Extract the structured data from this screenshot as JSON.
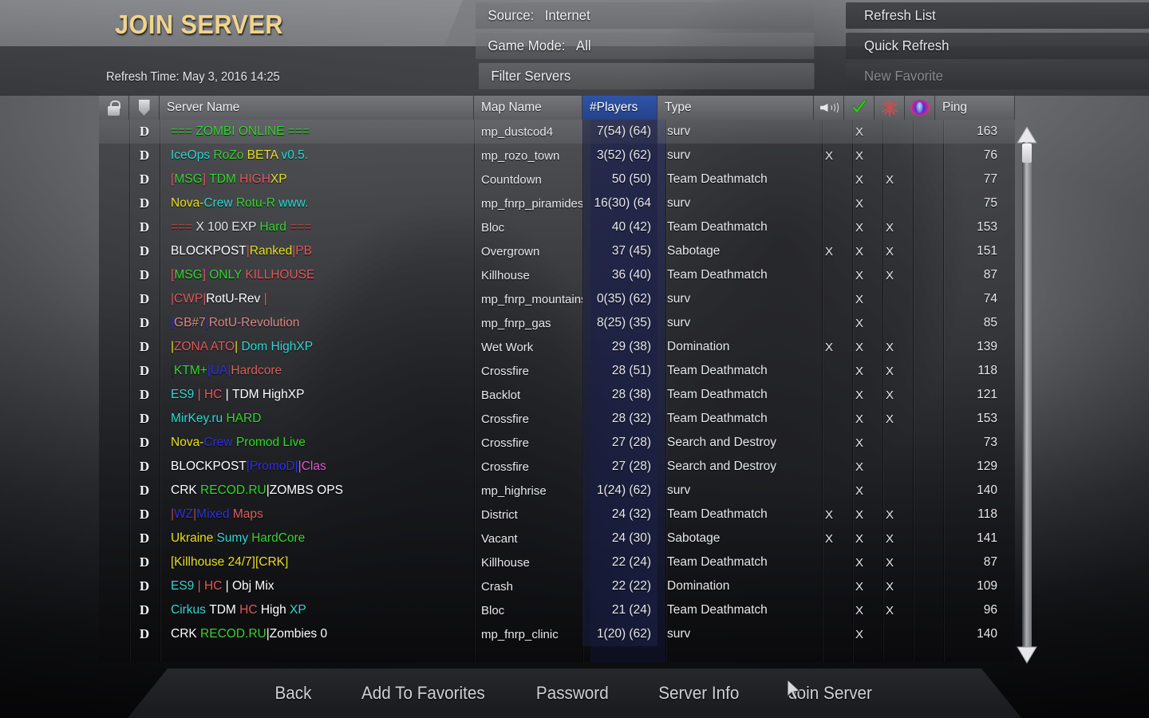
{
  "header": {
    "title": "JOIN SERVER",
    "refresh_time_label": "Refresh Time:",
    "refresh_time_value": "May 3, 2016  14:25"
  },
  "filters": {
    "source_label": "Source:",
    "source_value": "Internet",
    "gamemode_label": "Game Mode:",
    "gamemode_value": "All",
    "filter_servers_label": "Filter Servers"
  },
  "actions": {
    "refresh_list": "Refresh List",
    "quick_refresh": "Quick Refresh",
    "new_favorite": "New Favorite"
  },
  "columns": {
    "lock": "lock-icon",
    "mods": "shield-icon",
    "server_name": "Server Name",
    "map_name": "Map Name",
    "players": "#Players",
    "type": "Type",
    "voice": "speaker-icon",
    "pure": "green-check-icon",
    "mod": "red-star-icon",
    "dedicated": "globe-icon",
    "ping": "Ping",
    "sorted_column": "#Players"
  },
  "colors": {
    "title": "#f0d48c",
    "sorted_header": "#2f55a8",
    "green": "#38d430",
    "cyan": "#2fd9d0",
    "yellow": "#e8e020",
    "red": "#e05a5a",
    "blue": "#3030e0",
    "magenta": "#d95fd0",
    "white": "#ffffff"
  },
  "rows": [
    {
      "ded": "D",
      "name_segments": [
        {
          "t": "=== ",
          "c": "#38d430"
        },
        {
          "t": "ZOMBI ONLINE",
          "c": "#38d430"
        },
        {
          "t": " ===",
          "c": "#38d430"
        }
      ],
      "map": "mp_dustcod4",
      "players": "7(54) (64)",
      "type": "surv",
      "voice": "",
      "pure": "X",
      "mod": "",
      "dedicated": "",
      "ping": "163",
      "selected": true
    },
    {
      "ded": "D",
      "name_segments": [
        {
          "t": "IceOps ",
          "c": "#2fd9d0"
        },
        {
          "t": "RoZo ",
          "c": "#38d430"
        },
        {
          "t": "BETA ",
          "c": "#e8e020"
        },
        {
          "t": "v0.5.",
          "c": "#2fd9d0"
        }
      ],
      "map": "mp_rozo_town",
      "players": "3(52) (62)",
      "type": "surv",
      "voice": "X",
      "pure": "X",
      "mod": "",
      "dedicated": "",
      "ping": "76",
      "selected": false
    },
    {
      "ded": "D",
      "name_segments": [
        {
          "t": "[",
          "c": "#e05a5a"
        },
        {
          "t": "MSG",
          "c": "#38d430"
        },
        {
          "t": "] ",
          "c": "#e05a5a"
        },
        {
          "t": "TDM ",
          "c": "#38d430"
        },
        {
          "t": "HIGH",
          "c": "#e05a5a"
        },
        {
          "t": "XP",
          "c": "#e8e020"
        }
      ],
      "map": "Countdown",
      "players": "50 (50)",
      "type": "Team Deathmatch",
      "voice": "",
      "pure": "X",
      "mod": "X",
      "dedicated": "",
      "ping": "77",
      "selected": false
    },
    {
      "ded": "D",
      "name_segments": [
        {
          "t": "Nova-",
          "c": "#e8e020"
        },
        {
          "t": "Crew ",
          "c": "#2fd9d0"
        },
        {
          "t": "Rotu-R ",
          "c": "#38d430"
        },
        {
          "t": "www.",
          "c": "#2fd9d0"
        }
      ],
      "map": "mp_fnrp_piramides",
      "players": "16(30) (64",
      "type": "surv",
      "voice": "",
      "pure": "X",
      "mod": "",
      "dedicated": "",
      "ping": "75",
      "selected": false
    },
    {
      "ded": "D",
      "name_segments": [
        {
          "t": "=== ",
          "c": "#c04a4a"
        },
        {
          "t": "X 100 EXP ",
          "c": "#e9e9ec"
        },
        {
          "t": "Hard ",
          "c": "#38d430"
        },
        {
          "t": "===",
          "c": "#c04a4a"
        }
      ],
      "map": "Bloc",
      "players": "40 (42)",
      "type": "Team Deathmatch",
      "voice": "",
      "pure": "X",
      "mod": "X",
      "dedicated": "",
      "ping": "153",
      "selected": false
    },
    {
      "ded": "D",
      "name_segments": [
        {
          "t": "BLOCKPOST",
          "c": "#ffffff"
        },
        {
          "t": "|",
          "c": "#e05a5a"
        },
        {
          "t": "Ranked",
          "c": "#e8e020"
        },
        {
          "t": "|",
          "c": "#e05a5a"
        },
        {
          "t": "PB",
          "c": "#e05a5a"
        }
      ],
      "map": "Overgrown",
      "players": "37 (45)",
      "type": "Sabotage",
      "voice": "X",
      "pure": "X",
      "mod": "X",
      "dedicated": "",
      "ping": "151",
      "selected": false
    },
    {
      "ded": "D",
      "name_segments": [
        {
          "t": "[",
          "c": "#e05a5a"
        },
        {
          "t": "MSG",
          "c": "#38d430"
        },
        {
          "t": "] ",
          "c": "#e05a5a"
        },
        {
          "t": "ONLY ",
          "c": "#38d430"
        },
        {
          "t": "KILLHOUSE",
          "c": "#e05a5a"
        }
      ],
      "map": "Killhouse",
      "players": "36 (40)",
      "type": "Team Deathmatch",
      "voice": "",
      "pure": "X",
      "mod": "X",
      "dedicated": "",
      "ping": "87",
      "selected": false
    },
    {
      "ded": "D",
      "name_segments": [
        {
          "t": "|",
          "c": "#e05a5a"
        },
        {
          "t": "CWP",
          "c": "#e05a5a"
        },
        {
          "t": "|",
          "c": "#e05a5a"
        },
        {
          "t": "RotU-Rev ",
          "c": "#ffffff"
        },
        {
          "t": "|",
          "c": "#e05a5a"
        }
      ],
      "map": "mp_fnrp_mountains",
      "players": "0(35) (62)",
      "type": "surv",
      "voice": "",
      "pure": "X",
      "mod": "",
      "dedicated": "",
      "ping": "74",
      "selected": false
    },
    {
      "ded": "D",
      "name_segments": [
        {
          "t": "|",
          "c": "#3030e0"
        },
        {
          "t": "GB#7",
          "c": "#d98a8a"
        },
        {
          "t": "|",
          "c": "#3030e0"
        },
        {
          "t": "RotU-Revolution",
          "c": "#d98a8a"
        }
      ],
      "map": "mp_fnrp_gas",
      "players": "8(25) (35)",
      "type": "surv",
      "voice": "",
      "pure": "X",
      "mod": "",
      "dedicated": "",
      "ping": "85",
      "selected": false
    },
    {
      "ded": "D",
      "name_segments": [
        {
          "t": "|",
          "c": "#e8e020"
        },
        {
          "t": "ZONA ATO",
          "c": "#e05a5a"
        },
        {
          "t": "|",
          "c": "#e8e020"
        },
        {
          "t": " Dom HighXP",
          "c": "#2fd9d0"
        }
      ],
      "map": "Wet Work",
      "players": "29 (38)",
      "type": "Domination",
      "voice": "X",
      "pure": "X",
      "mod": "X",
      "dedicated": "",
      "ping": "139",
      "selected": false
    },
    {
      "ded": "D",
      "name_segments": [
        {
          "t": "|",
          "c": "#2a2a2a"
        },
        {
          "t": "KTM+",
          "c": "#38d430"
        },
        {
          "t": "|",
          "c": "#3030e0"
        },
        {
          "t": "UA",
          "c": "#3030e0"
        },
        {
          "t": "|",
          "c": "#3030e0"
        },
        {
          "t": "Hardcore",
          "c": "#d96060"
        }
      ],
      "map": "Crossfire",
      "players": "28 (51)",
      "type": "Team Deathmatch",
      "voice": "",
      "pure": "X",
      "mod": "X",
      "dedicated": "",
      "ping": "118",
      "selected": false
    },
    {
      "ded": "D",
      "name_segments": [
        {
          "t": "ES9 ",
          "c": "#2fd9d0"
        },
        {
          "t": "| ",
          "c": "#e05a5a"
        },
        {
          "t": "HC ",
          "c": "#e05a5a"
        },
        {
          "t": "| ",
          "c": "#ffffff"
        },
        {
          "t": "TDM HighXP",
          "c": "#ffffff"
        }
      ],
      "map": "Backlot",
      "players": "28 (38)",
      "type": "Team Deathmatch",
      "voice": "",
      "pure": "X",
      "mod": "X",
      "dedicated": "",
      "ping": "121",
      "selected": false
    },
    {
      "ded": "D",
      "name_segments": [
        {
          "t": "MirKey.ru ",
          "c": "#2fd9d0"
        },
        {
          "t": "HARD",
          "c": "#38d430"
        }
      ],
      "map": "Crossfire",
      "players": "28 (32)",
      "type": "Team Deathmatch",
      "voice": "",
      "pure": "X",
      "mod": "X",
      "dedicated": "",
      "ping": "153",
      "selected": false
    },
    {
      "ded": "D",
      "name_segments": [
        {
          "t": "Nova-",
          "c": "#e8e020"
        },
        {
          "t": "Crew",
          "c": "#3030e0"
        },
        {
          "t": " Promod Live",
          "c": "#38d430"
        }
      ],
      "map": "Crossfire",
      "players": "27 (28)",
      "type": "Search and Destroy",
      "voice": "",
      "pure": "X",
      "mod": "",
      "dedicated": "",
      "ping": "73",
      "selected": false
    },
    {
      "ded": "D",
      "name_segments": [
        {
          "t": "BLOCKPOST",
          "c": "#ffffff"
        },
        {
          "t": "|",
          "c": "#3030e0"
        },
        {
          "t": "PromoD",
          "c": "#3030e0"
        },
        {
          "t": "|",
          "c": "#3030e0"
        },
        {
          "t": "|",
          "c": "#d95fd0"
        },
        {
          "t": "Clas",
          "c": "#d95fd0"
        }
      ],
      "map": "Crossfire",
      "players": "27 (28)",
      "type": "Search and Destroy",
      "voice": "",
      "pure": "X",
      "mod": "",
      "dedicated": "",
      "ping": "129",
      "selected": false
    },
    {
      "ded": "D",
      "name_segments": [
        {
          "t": "CRK ",
          "c": "#ffffff"
        },
        {
          "t": "RECOD.RU",
          "c": "#38d430"
        },
        {
          "t": "|",
          "c": "#ffffff"
        },
        {
          "t": "ZOMBS OPS",
          "c": "#ffffff"
        }
      ],
      "map": "mp_highrise",
      "players": "1(24) (62)",
      "type": "surv",
      "voice": "",
      "pure": "X",
      "mod": "",
      "dedicated": "",
      "ping": "140",
      "selected": false
    },
    {
      "ded": "D",
      "name_segments": [
        {
          "t": "|",
          "c": "#b05050"
        },
        {
          "t": "WZ",
          "c": "#3030e0"
        },
        {
          "t": "|",
          "c": "#b05050"
        },
        {
          "t": "Mixed",
          "c": "#3030e0"
        },
        {
          "t": " Maps",
          "c": "#d96060"
        }
      ],
      "map": "District",
      "players": "24 (32)",
      "type": "Team Deathmatch",
      "voice": "X",
      "pure": "X",
      "mod": "X",
      "dedicated": "",
      "ping": "118",
      "selected": false
    },
    {
      "ded": "D",
      "name_segments": [
        {
          "t": "Ukraine",
          "c": "#e8e020"
        },
        {
          "t": "|",
          "c": "#2a2a2a"
        },
        {
          "t": "Sumy",
          "c": "#2fd9d0"
        },
        {
          "t": "|",
          "c": "#2a2a2a"
        },
        {
          "t": "HardCore",
          "c": "#38d430"
        }
      ],
      "map": "Vacant",
      "players": "24 (30)",
      "type": "Sabotage",
      "voice": "X",
      "pure": "X",
      "mod": "X",
      "dedicated": "",
      "ping": "141",
      "selected": false
    },
    {
      "ded": "D",
      "name_segments": [
        {
          "t": "[Killhouse 24/7][CRK]",
          "c": "#e8e020"
        }
      ],
      "map": "Killhouse",
      "players": "22 (24)",
      "type": "Team Deathmatch",
      "voice": "",
      "pure": "X",
      "mod": "X",
      "dedicated": "",
      "ping": "87",
      "selected": false
    },
    {
      "ded": "D",
      "name_segments": [
        {
          "t": "ES9 ",
          "c": "#2fd9d0"
        },
        {
          "t": "| ",
          "c": "#e05a5a"
        },
        {
          "t": "HC ",
          "c": "#e05a5a"
        },
        {
          "t": "| ",
          "c": "#ffffff"
        },
        {
          "t": "Obj Mix",
          "c": "#ffffff"
        }
      ],
      "map": "Crash",
      "players": "22 (22)",
      "type": "Domination",
      "voice": "",
      "pure": "X",
      "mod": "X",
      "dedicated": "",
      "ping": "109",
      "selected": false
    },
    {
      "ded": "D",
      "name_segments": [
        {
          "t": "Cirkus ",
          "c": "#2fd9d0"
        },
        {
          "t": "TDM ",
          "c": "#ffffff"
        },
        {
          "t": "HC ",
          "c": "#e05a5a"
        },
        {
          "t": "High ",
          "c": "#ffffff"
        },
        {
          "t": "XP",
          "c": "#2fd9d0"
        }
      ],
      "map": "Bloc",
      "players": "21 (24)",
      "type": "Team Deathmatch",
      "voice": "",
      "pure": "X",
      "mod": "X",
      "dedicated": "",
      "ping": "96",
      "selected": false
    },
    {
      "ded": "D",
      "name_segments": [
        {
          "t": "CRK ",
          "c": "#ffffff"
        },
        {
          "t": "RECOD.RU",
          "c": "#38d430"
        },
        {
          "t": "|",
          "c": "#ffffff"
        },
        {
          "t": "Zombies 0",
          "c": "#ffffff"
        }
      ],
      "map": "mp_fnrp_clinic",
      "players": "1(20) (62)",
      "type": "surv",
      "voice": "",
      "pure": "X",
      "mod": "",
      "dedicated": "",
      "ping": "140",
      "selected": false
    }
  ],
  "bottom_buttons": [
    {
      "label": "Back"
    },
    {
      "label": "Add To Favorites"
    },
    {
      "label": "Password"
    },
    {
      "label": "Server Info"
    },
    {
      "label": "Join Server"
    }
  ]
}
